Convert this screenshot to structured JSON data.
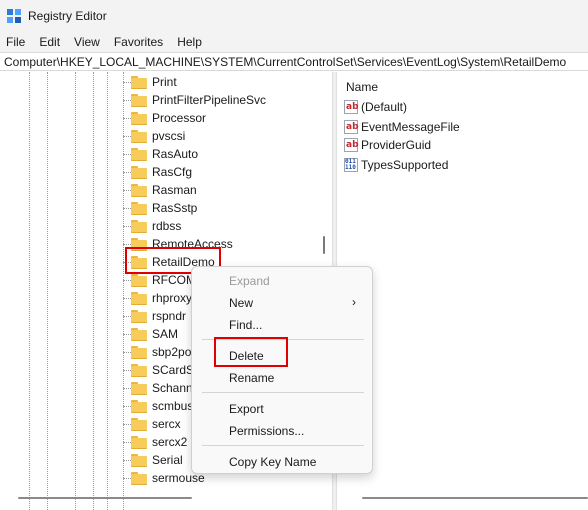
{
  "window": {
    "title": "Registry Editor"
  },
  "menu": [
    "File",
    "Edit",
    "View",
    "Favorites",
    "Help"
  ],
  "address": "Computer\\HKEY_LOCAL_MACHINE\\SYSTEM\\CurrentControlSet\\Services\\EventLog\\System\\RetailDemo",
  "tree": {
    "items": [
      "Print",
      "PrintFilterPipelineSvc",
      "Processor",
      "pvscsi",
      "RasAuto",
      "RasCfg",
      "Rasman",
      "RasSstp",
      "rdbss",
      "RemoteAccess",
      "RetailDemo",
      "RFCOM",
      "rhproxy",
      "rspndr",
      "SAM",
      "sbp2po",
      "SCardS",
      "Schann",
      "scmbus",
      "sercx",
      "sercx2",
      "Serial",
      "sermouse"
    ],
    "selected": "RetailDemo"
  },
  "values": {
    "column_name": "Name",
    "rows": [
      {
        "name": "(Default)",
        "icon": "string-value-icon"
      },
      {
        "name": "EventMessageFile",
        "icon": "string-value-icon"
      },
      {
        "name": "ProviderGuid",
        "icon": "string-value-icon"
      },
      {
        "name": "TypesSupported",
        "icon": "binary-value-icon"
      }
    ]
  },
  "context_menu": {
    "expand": "Expand",
    "new": "New",
    "find": "Find...",
    "delete": "Delete",
    "rename": "Rename",
    "export": "Export",
    "permissions": "Permissions...",
    "copy_key_name": "Copy Key Name",
    "submenu_arrow": "›"
  },
  "colors": {
    "highlight": "#e00000",
    "folder": "#f7cc5a"
  }
}
